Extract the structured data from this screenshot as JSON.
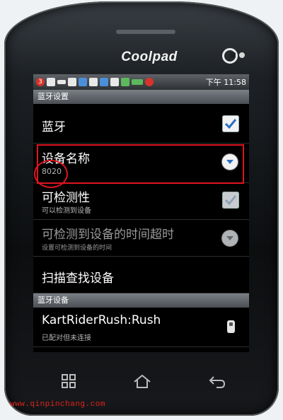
{
  "device": {
    "brand": "Coolpad"
  },
  "status_bar": {
    "notification_count": "3",
    "time": "下午 11:58"
  },
  "sections": {
    "bluetooth_settings": "蓝牙设置",
    "bluetooth_devices": "蓝牙设备"
  },
  "settings": {
    "bluetooth": {
      "title": "蓝牙",
      "checked": true
    },
    "device_name": {
      "title": "设备名称",
      "value": "8020"
    },
    "discoverable": {
      "title": "可检测性",
      "subtitle": "可以检测到设备",
      "checked": true
    },
    "discoverable_timeout": {
      "title": "可检测到设备的时间超时",
      "subtitle": "设置可检测到设备的时间"
    },
    "scan": {
      "title": "扫描查找设备"
    }
  },
  "devices": [
    {
      "name": "KartRiderRush:Rush",
      "status": "已配对但未连接"
    }
  ],
  "watermark": "www.qinpinchang.com",
  "colors": {
    "annotation": "#e0141f",
    "checkmark": "#2a6fc2"
  }
}
